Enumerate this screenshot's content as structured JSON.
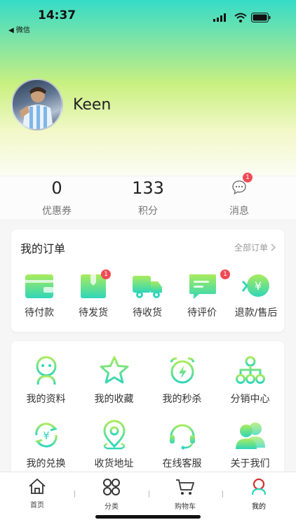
{
  "status_bar": {
    "time": "14:37",
    "back_app": "◀ 微信"
  },
  "profile": {
    "name": "Keen"
  },
  "stats": [
    {
      "value": "0",
      "label": "优惠券"
    },
    {
      "value": "133",
      "label": "积分"
    },
    {
      "label": "消息",
      "badge": "1"
    }
  ],
  "orders": {
    "title": "我的订单",
    "all_label": "全部订单",
    "items": [
      {
        "label": "待付款",
        "icon": "wallet-icon"
      },
      {
        "label": "待发货",
        "icon": "package-icon",
        "badge": "1"
      },
      {
        "label": "待收货",
        "icon": "truck-icon"
      },
      {
        "label": "待评价",
        "icon": "comment-icon",
        "badge": "1"
      },
      {
        "label": "退款/售后",
        "icon": "refund-icon"
      }
    ]
  },
  "services": [
    {
      "label": "我的资料",
      "icon": "profile-icon"
    },
    {
      "label": "我的收藏",
      "icon": "star-icon"
    },
    {
      "label": "我的秒杀",
      "icon": "alarm-icon"
    },
    {
      "label": "分销中心",
      "icon": "network-icon"
    },
    {
      "label": "我的兑换",
      "icon": "exchange-icon"
    },
    {
      "label": "收货地址",
      "icon": "location-icon"
    },
    {
      "label": "在线客服",
      "icon": "headset-icon"
    },
    {
      "label": "关于我们",
      "icon": "users-icon"
    }
  ],
  "tabbar": [
    {
      "label": "首页",
      "icon": "home-icon"
    },
    {
      "label": "分类",
      "icon": "category-icon"
    },
    {
      "label": "购物车",
      "icon": "cart-icon"
    },
    {
      "label": "我的",
      "icon": "user-tab-icon",
      "active": true
    }
  ],
  "colors": {
    "accent_start": "#35dcc7",
    "accent_end": "#c9f080",
    "badge": "#ef4b55",
    "tab_active": "#d32f2f"
  }
}
